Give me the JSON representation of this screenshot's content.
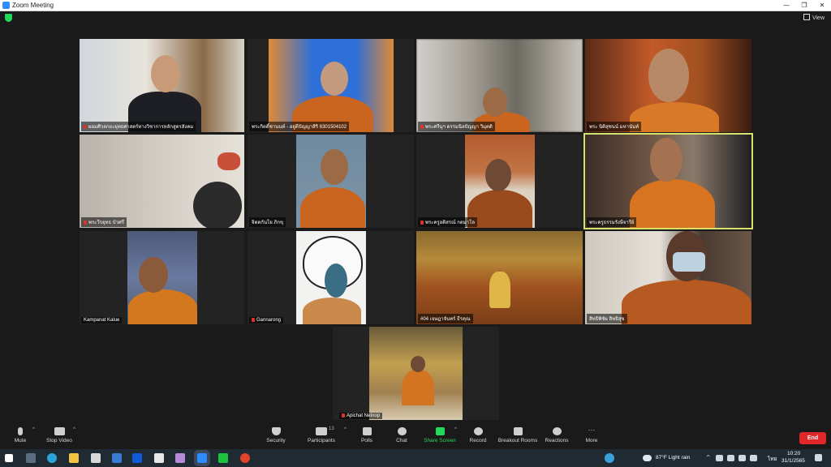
{
  "window": {
    "title": "Zoom Meeting",
    "view_label": "View"
  },
  "participants": [
    {
      "name": "ผอมศิวลกยะยุทธศาสตร์ทางวิชาการหลักสูตรสังคม",
      "muted": true
    },
    {
      "name": "พระกิตติ์ชานนท์ - อยู่ดีปัญญาสิริ 6301504102",
      "muted": false
    },
    {
      "name": "พระศรีนุฯ ดรรมนิลปัญญา วิมุตติ",
      "muted": true
    },
    {
      "name": "พระ นิติสุชนน์ มหานันท์",
      "muted": false
    },
    {
      "name": "พระวีรยุทธ บัวศรี",
      "muted": true
    },
    {
      "name": "จิตตกันโย ภิกขุ",
      "muted": false
    },
    {
      "name": "พระครูอดิสรณ์ กตมาโล",
      "muted": true
    },
    {
      "name": "พระครูธรรมรังษีจารีย์",
      "muted": false
    },
    {
      "name": "Kampanat Kalue",
      "muted": false
    },
    {
      "name": "Gannarong",
      "muted": true
    },
    {
      "name": "#04 เจษฎาจันทร์ ธีรคุณ",
      "muted": false
    },
    {
      "name": "สิทธิพิชัย สิทธิสุข",
      "muted": false
    },
    {
      "name": "Apichat Netnop",
      "muted": true
    }
  ],
  "toolbar": {
    "mute": "Mute",
    "stop_video": "Stop Video",
    "security": "Security",
    "participants": "Participants",
    "participants_count": "13",
    "polls": "Polls",
    "chat": "Chat",
    "share_screen": "Share Screen",
    "record": "Record",
    "breakout_rooms": "Breakout Rooms",
    "reactions": "Reactions",
    "more": "More",
    "end": "End"
  },
  "taskbar": {
    "weather": "87°F  Light rain",
    "language": "ไทย",
    "time": "10:20",
    "date": "31/1/2565"
  },
  "colors": {
    "accent_green": "#23d959",
    "end_red": "#e02828",
    "active_border": "#d6e26b"
  }
}
